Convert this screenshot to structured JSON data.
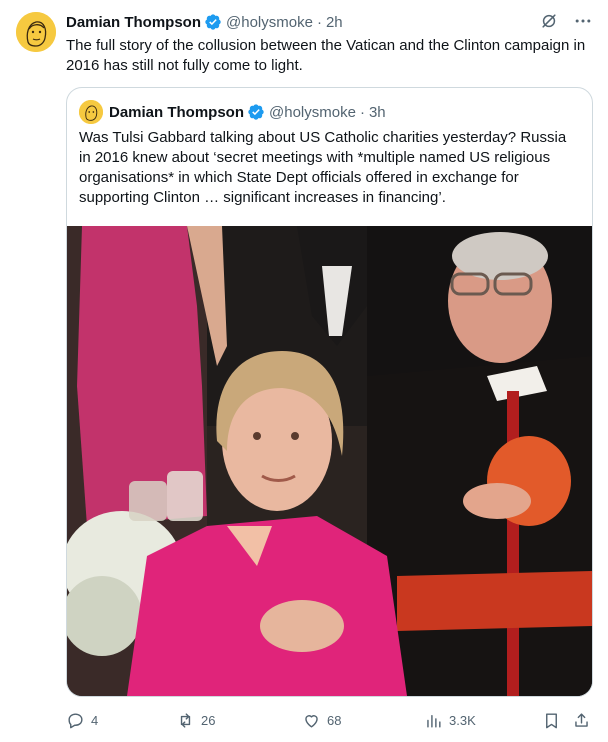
{
  "tweet": {
    "author_name": "Damian Thompson",
    "author_handle": "@holysmoke",
    "separator": "·",
    "time": "2h",
    "text": "The full story of the collusion between the Vatican and the Clinton campaign in 2016 has still not fully come to light.",
    "avatar_color": "#f6c940",
    "verified_color": "#1d9bf0"
  },
  "quote": {
    "author_name": "Damian Thompson",
    "author_handle": "@holysmoke",
    "separator": "·",
    "time": "3h",
    "text": "Was Tulsi Gabbard talking about US Catholic charities yesterday? Russia in 2016 knew about ‘secret meetings with *multiple named US religious organisations* in which State Dept officials offered in exchange for supporting Clinton … significant increases in financing’.",
    "media_description_icon": "photo"
  },
  "actions": {
    "replies": "4",
    "reposts": "26",
    "likes": "68",
    "views": "3.3K"
  },
  "icons": {
    "grok": "grok-icon",
    "more": "more-icon",
    "reply": "reply-icon",
    "repost": "repost-icon",
    "like": "like-icon",
    "views": "views-icon",
    "bookmark": "bookmark-icon",
    "share": "share-icon"
  },
  "colors": {
    "text_primary": "#0f1419",
    "text_secondary": "#536471",
    "border": "#cfd9de"
  }
}
